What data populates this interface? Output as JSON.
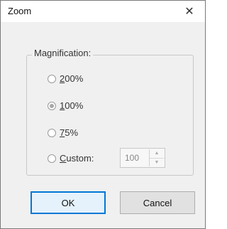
{
  "dialog": {
    "title": "Zoom",
    "close_glyph": "✕"
  },
  "magnification": {
    "legend": "Magnification:",
    "options": [
      {
        "label": "200%",
        "access_key": "2",
        "rest": "00%",
        "selected": false
      },
      {
        "label": "100%",
        "access_key": "1",
        "rest": "00%",
        "selected": true
      },
      {
        "label": "75%",
        "access_key": "7",
        "rest": "5%",
        "selected": false
      },
      {
        "label": "Custom:",
        "access_key": "C",
        "rest": "ustom:",
        "selected": false
      }
    ],
    "custom_value": "100",
    "spin_up_icon": "▲",
    "spin_down_icon": "▼"
  },
  "buttons": {
    "ok": "OK",
    "cancel": "Cancel"
  },
  "colors": {
    "accent": "#0078d7",
    "dialog_bg": "#f0f0f0",
    "titlebar_bg": "#ffffff"
  }
}
